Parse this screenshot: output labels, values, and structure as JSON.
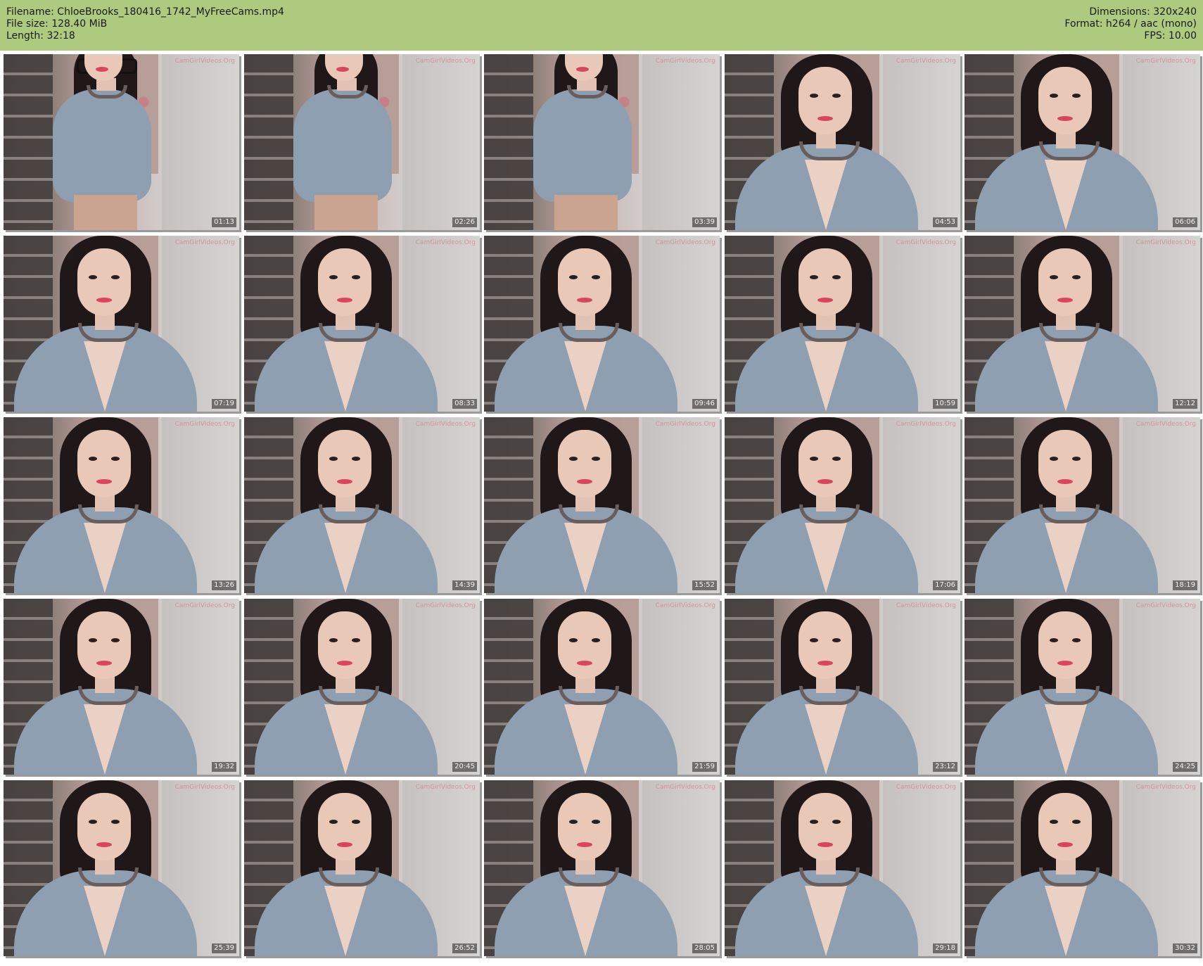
{
  "meta": {
    "filename": "Filename: ChloeBrooks_180416_1742_MyFreeCams.mp4",
    "filesize": "File size: 128.40 MiB",
    "length": "Length: 32:18",
    "dimensions": "Dimensions: 320x240",
    "format": "Format: h264 / aac (mono)",
    "fps": "FPS: 10.00"
  },
  "colors": {
    "header_bg": "#adca7e",
    "page_bg": "#ffffff"
  },
  "thumbnails": [
    {
      "time": "01:13",
      "watermark": "CamGirlVideos.Org",
      "pose": "body"
    },
    {
      "time": "02:26",
      "watermark": "CamGirlVideos.Org",
      "pose": "body"
    },
    {
      "time": "03:39",
      "watermark": "CamGirlVideos.Org",
      "pose": "body"
    },
    {
      "time": "04:53",
      "watermark": "CamGirlVideos.Org",
      "pose": "face"
    },
    {
      "time": "06:06",
      "watermark": "CamGirlVideos.Org",
      "pose": "face"
    },
    {
      "time": "07:19",
      "watermark": "CamGirlVideos.Org",
      "pose": "face"
    },
    {
      "time": "08:33",
      "watermark": "CamGirlVideos.Org",
      "pose": "face"
    },
    {
      "time": "09:46",
      "watermark": "CamGirlVideos.Org",
      "pose": "face"
    },
    {
      "time": "10:59",
      "watermark": "CamGirlVideos.Org",
      "pose": "face"
    },
    {
      "time": "12:12",
      "watermark": "CamGirlVideos.Org",
      "pose": "face"
    },
    {
      "time": "13:26",
      "watermark": "CamGirlVideos.Org",
      "pose": "face"
    },
    {
      "time": "14:39",
      "watermark": "CamGirlVideos.Org",
      "pose": "face"
    },
    {
      "time": "15:52",
      "watermark": "CamGirlVideos.Org",
      "pose": "face"
    },
    {
      "time": "17:06",
      "watermark": "CamGirlVideos.Org",
      "pose": "face"
    },
    {
      "time": "18:19",
      "watermark": "CamGirlVideos.Org",
      "pose": "face"
    },
    {
      "time": "19:32",
      "watermark": "CamGirlVideos.Org",
      "pose": "face"
    },
    {
      "time": "20:45",
      "watermark": "CamGirlVideos.Org",
      "pose": "face"
    },
    {
      "time": "21:59",
      "watermark": "CamGirlVideos.Org",
      "pose": "face"
    },
    {
      "time": "23:12",
      "watermark": "CamGirlVideos.Org",
      "pose": "face"
    },
    {
      "time": "24:25",
      "watermark": "CamGirlVideos.Org",
      "pose": "face"
    },
    {
      "time": "25:39",
      "watermark": "CamGirlVideos.Org",
      "pose": "face"
    },
    {
      "time": "26:52",
      "watermark": "CamGirlVideos.Org",
      "pose": "face"
    },
    {
      "time": "28:05",
      "watermark": "CamGirlVideos.Org",
      "pose": "face"
    },
    {
      "time": "29:18",
      "watermark": "CamGirlVideos.Org",
      "pose": "face"
    },
    {
      "time": "30:32",
      "watermark": "CamGirlVideos.Org",
      "pose": "face"
    }
  ]
}
